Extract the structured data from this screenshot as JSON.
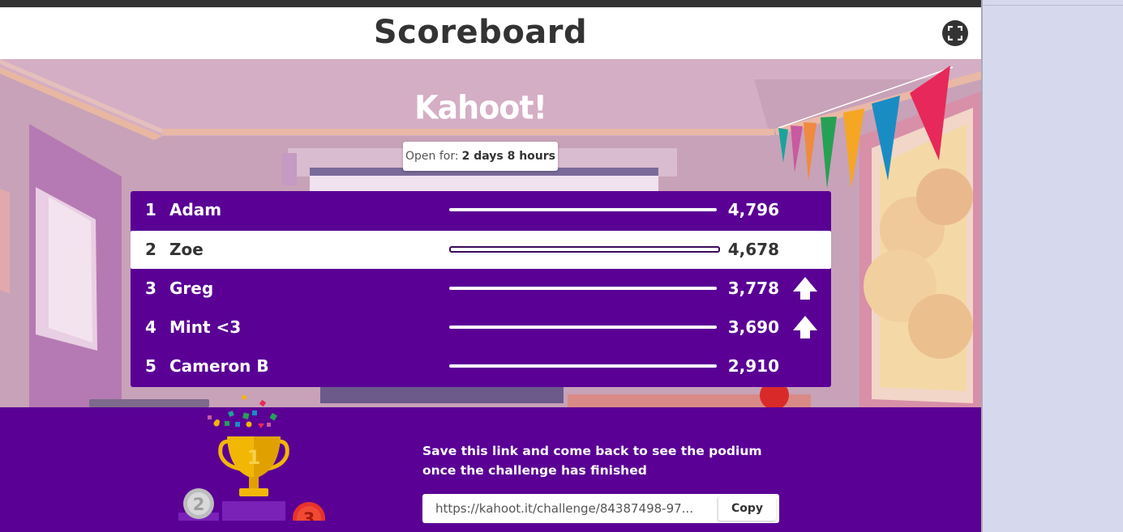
{
  "header": {
    "title": "Scoreboard",
    "fullscreen_icon": "fullscreen-icon"
  },
  "stage": {
    "logo": "Kahoot!",
    "open_for_label": "Open for:",
    "open_for_value": "2 days 8 hours"
  },
  "scoreboard": {
    "rows": [
      {
        "rank": "1",
        "name": "Adam",
        "score": "4,796",
        "highlight": false,
        "trend": ""
      },
      {
        "rank": "2",
        "name": "Zoe",
        "score": "4,678",
        "highlight": true,
        "trend": ""
      },
      {
        "rank": "3",
        "name": "Greg",
        "score": "3,778",
        "highlight": false,
        "trend": "up-arrow-icon"
      },
      {
        "rank": "4",
        "name": "Mint <3",
        "score": "3,690",
        "highlight": false,
        "trend": "up-arrow-icon"
      },
      {
        "rank": "5",
        "name": "Cameron B",
        "score": "2,910",
        "highlight": false,
        "trend": ""
      }
    ]
  },
  "footer": {
    "save_text": "Save this link and come back to see the podium once the challenge has finished",
    "link_value": "https://kahoot.it/challenge/84387498-97...",
    "copy_label": "Copy",
    "podium": {
      "first": "1",
      "second": "2",
      "third": "3"
    }
  },
  "colors": {
    "purple": "#5a0095",
    "gold": "#f2b705",
    "room": "#c59eb6"
  }
}
